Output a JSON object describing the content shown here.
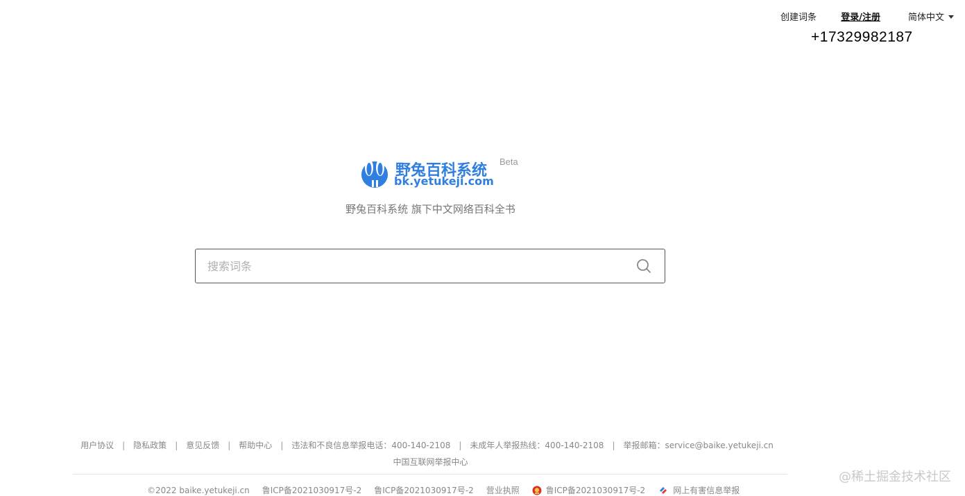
{
  "header": {
    "create_entry": "创建词条",
    "login_register": "登录/注册",
    "language": "简体中文",
    "phone": "+17329982187"
  },
  "logo": {
    "name": "野兔百科系统",
    "domain": "bk.yetukeji.com",
    "badge": "Beta",
    "brand_color": "#2f7fe0"
  },
  "tagline": "野兔百科系统 旗下中文网络百科全书",
  "search": {
    "placeholder": "搜索词条",
    "value": "",
    "icon": "search-icon"
  },
  "footer": {
    "links": [
      "用户协议",
      "隐私政策",
      "意见反馈",
      "帮助中心",
      "违法和不良信息举报电话：400-140-2108",
      "未成年人举报热线：400-140-2108",
      "举报邮箱：service@baike.yetukeji.cn"
    ],
    "separator": "|",
    "report_center": "中国互联网举报中心",
    "bottom": {
      "copyright": "©2022 baike.yetukeji.cn",
      "icp1": "鲁ICP备2021030917号-2",
      "icp2": "鲁ICP备2021030917号-2",
      "business_license": "营业执照",
      "icp3": "鲁ICP备2021030917号-2",
      "harmful_report": "网上有害信息举报"
    }
  },
  "watermark": "@稀土掘金技术社区"
}
